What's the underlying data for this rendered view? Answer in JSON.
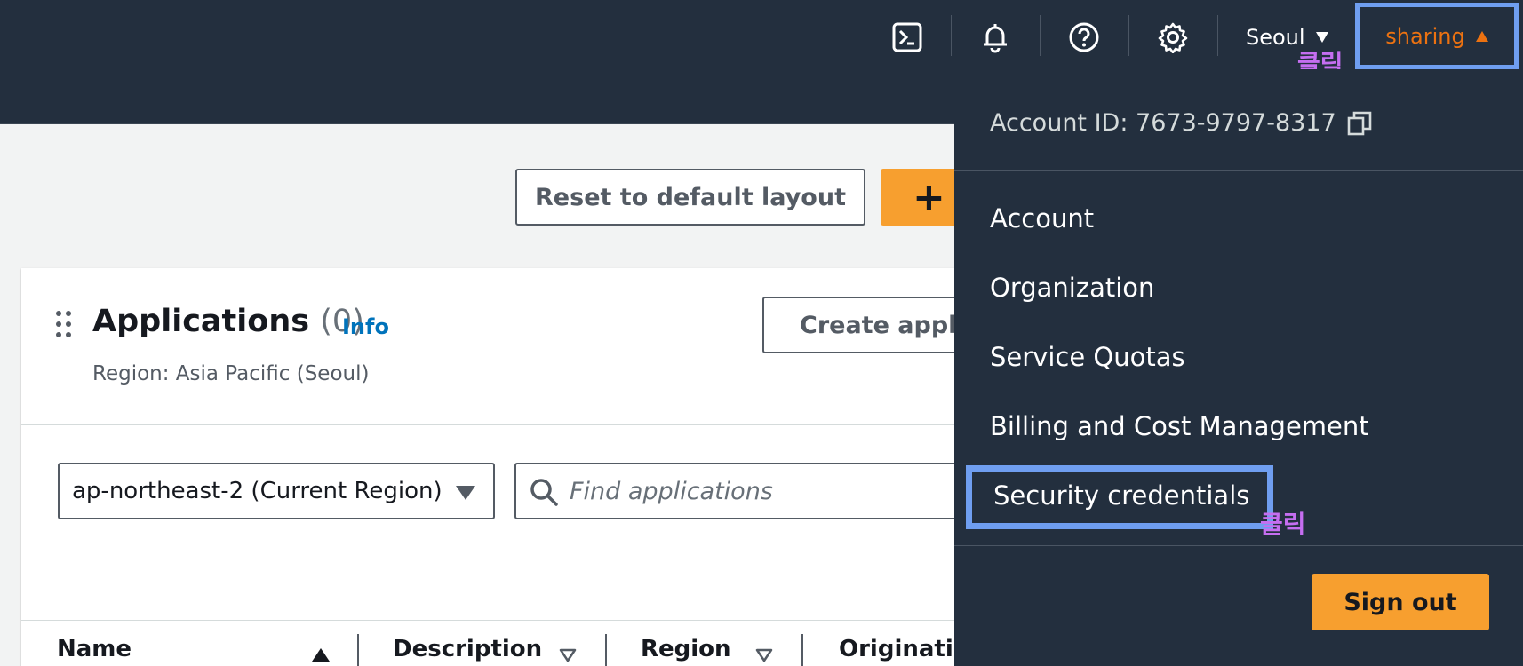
{
  "topnav": {
    "region_label": "Seoul",
    "user_label": "sharing",
    "click_note_user": "클릭",
    "accent_color": "#ec7211",
    "icons": [
      "cloudshell-icon",
      "bell-icon",
      "help-icon",
      "gear-icon"
    ]
  },
  "main": {
    "reset_label": "Reset to default layout",
    "add_label": "+"
  },
  "panel": {
    "title": "Applications",
    "count": "(0)",
    "info_label": "Info",
    "region_line": "Region: Asia Pacific (Seoul)",
    "create_label": "Create application",
    "region_select_value": "ap-northeast-2 (Current Region)",
    "search_placeholder": "Find applications",
    "columns": [
      "Name",
      "Description",
      "Region",
      "Originating"
    ]
  },
  "dropdown": {
    "account_id": "Account ID: 7673-9797-8317",
    "items": [
      "Account",
      "Organization",
      "Service Quotas",
      "Billing and Cost Management",
      "Security credentials"
    ],
    "click_note": "클릭",
    "signout_label": "Sign out"
  }
}
